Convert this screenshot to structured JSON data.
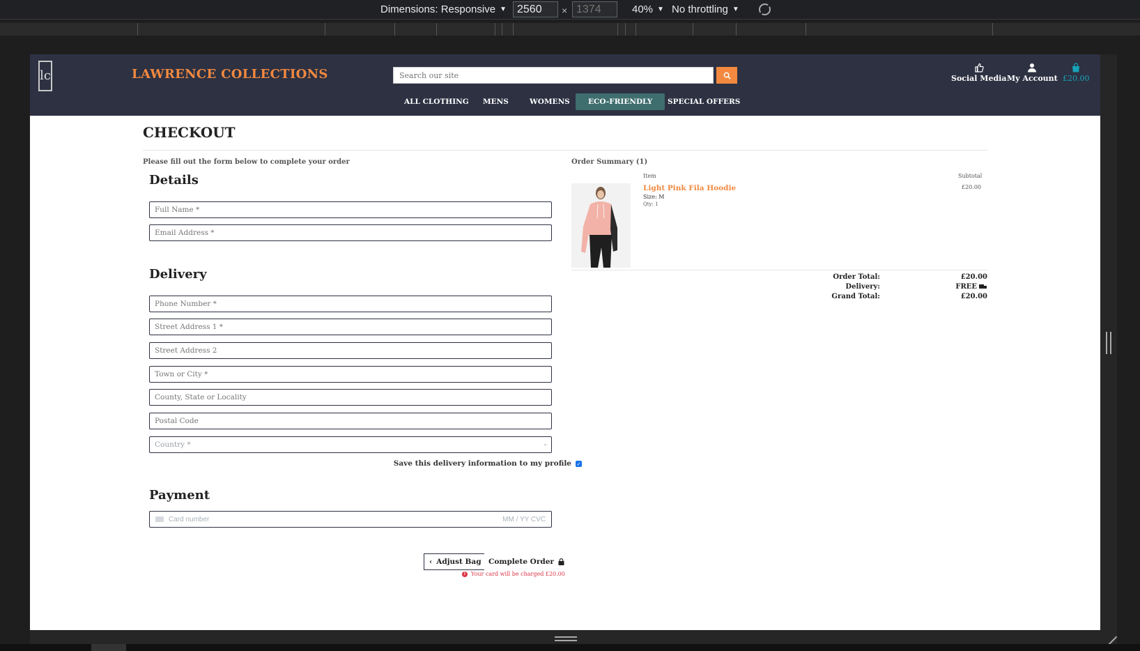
{
  "devtools": {
    "dimensions_label": "Dimensions: Responsive",
    "width": "2560",
    "height": "1374",
    "zoom": "40%",
    "throttling": "No throttling"
  },
  "header": {
    "logo_text": "lc",
    "brand": "LAWRENCE COLLECTIONS",
    "search_placeholder": "Search our site",
    "social_label": "Social Media",
    "account_label": "My Account",
    "bag_total": "£20.00"
  },
  "nav": {
    "items": [
      {
        "label": "ALL CLOTHING"
      },
      {
        "label": "MENS"
      },
      {
        "label": "WOMENS"
      },
      {
        "label": "ECO-FRIENDLY"
      },
      {
        "label": "SPECIAL OFFERS"
      }
    ]
  },
  "checkout": {
    "title": "CHECKOUT",
    "intro": "Please fill out the form below to complete your order",
    "details_heading": "Details",
    "full_name_placeholder": "Full Name *",
    "email_placeholder": "Email Address *",
    "delivery_heading": "Delivery",
    "phone_placeholder": "Phone Number *",
    "street1_placeholder": "Street Address 1 *",
    "street2_placeholder": "Street Address 2",
    "town_placeholder": "Town or City *",
    "county_placeholder": "County, State or Locality",
    "postcode_placeholder": "Postal Code",
    "country_placeholder": "Country *",
    "save_info_label": "Save this delivery information to my profile",
    "payment_heading": "Payment",
    "card_placeholder": "Card number",
    "card_expiry_cvc": "MM / YY  CVC",
    "adjust_bag_label": "Adjust Bag",
    "complete_order_label": "Complete Order",
    "charge_warning": "Your card will be charged £20.00"
  },
  "summary": {
    "heading": "Order Summary (1)",
    "col_item": "Item",
    "col_subtotal": "Subtotal",
    "product_name": "Light Pink Fila Hoodie",
    "product_size": "Size: M",
    "product_qty": "Qty: 1",
    "product_subtotal": "£20.00",
    "order_total_label": "Order Total:",
    "order_total": "£20.00",
    "delivery_label": "Delivery:",
    "delivery_value": "FREE",
    "grand_total_label": "Grand Total:",
    "grand_total": "£20.00"
  },
  "colors": {
    "header_bg": "#2d3142",
    "accent": "#f2893f",
    "active_nav": "#3f6e6e",
    "bag": "#17a2b8",
    "warning": "#dc3545"
  }
}
